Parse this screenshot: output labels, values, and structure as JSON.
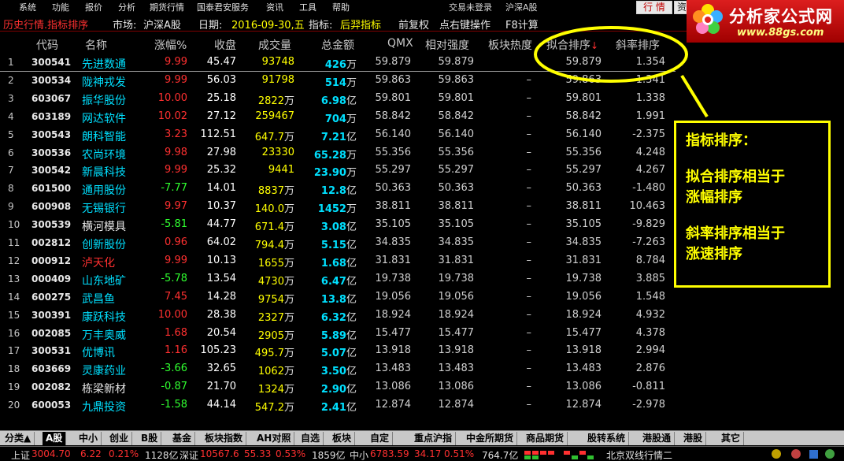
{
  "menu": {
    "items": [
      "系统",
      "功能",
      "报价",
      "分析",
      "期货行情",
      "国泰君安服务",
      "资讯",
      "工具",
      "帮助"
    ],
    "login": "交易未登录",
    "market": "沪深A股"
  },
  "titlebar": {
    "mode": "历史行情.指标排序",
    "market_label": "市场:",
    "market": "沪深A股",
    "date_label": "日期:",
    "date": "2016-09-30,五",
    "indicator_label": "指标:",
    "indicator": "后羿指标",
    "adjust": "前复权",
    "hint": "点右键操作",
    "f8": "F8计算",
    "btn_quote": "行 情",
    "btn_news": "资"
  },
  "logo": {
    "title": "分析家公式网",
    "url": "www.88gs.com"
  },
  "table": {
    "headers": [
      "代码",
      "名称",
      "涨幅%",
      "收盘",
      "成交量",
      "总金额",
      "QMX",
      "相对强度",
      "板块热度",
      "拟合排序",
      "斜率排序"
    ],
    "sort_indicator": "↓",
    "rows": [
      {
        "idx": "1",
        "code": "300541",
        "name": "先进数通",
        "nc": "cyan",
        "chg": "9.99",
        "dir": "up",
        "close": "45.47",
        "vol": "93748",
        "volu": "",
        "amt": "426",
        "amtu": "万",
        "qmx": "59.879",
        "rs": "59.879",
        "heat": "",
        "fit": "59.879",
        "slope": "1.354"
      },
      {
        "idx": "2",
        "code": "300534",
        "name": "陇神戎发",
        "nc": "cyan",
        "chg": "9.99",
        "dir": "up",
        "close": "56.03",
        "vol": "91798",
        "volu": "",
        "amt": "514",
        "amtu": "万",
        "qmx": "59.863",
        "rs": "59.863",
        "heat": "–",
        "fit": "59.863",
        "slope": "1.341"
      },
      {
        "idx": "3",
        "code": "603067",
        "name": "振华股份",
        "nc": "cyan",
        "chg": "10.00",
        "dir": "up",
        "close": "25.18",
        "vol": "2822",
        "volu": "万",
        "amt": "6.98",
        "amtu": "亿",
        "qmx": "59.801",
        "rs": "59.801",
        "heat": "–",
        "fit": "59.801",
        "slope": "1.338"
      },
      {
        "idx": "4",
        "code": "603189",
        "name": "网达软件",
        "nc": "cyan",
        "chg": "10.02",
        "dir": "up",
        "close": "27.12",
        "vol": "259467",
        "volu": "",
        "amt": "704",
        "amtu": "万",
        "qmx": "58.842",
        "rs": "58.842",
        "heat": "–",
        "fit": "58.842",
        "slope": "1.991"
      },
      {
        "idx": "5",
        "code": "300543",
        "name": "朗科智能",
        "nc": "cyan",
        "chg": "3.23",
        "dir": "up",
        "close": "112.51",
        "vol": "647.7",
        "volu": "万",
        "amt": "7.21",
        "amtu": "亿",
        "qmx": "56.140",
        "rs": "56.140",
        "heat": "–",
        "fit": "56.140",
        "slope": "-2.375"
      },
      {
        "idx": "6",
        "code": "300536",
        "name": "农尚环境",
        "nc": "cyan",
        "chg": "9.98",
        "dir": "up",
        "close": "27.98",
        "vol": "23330",
        "volu": "",
        "amt": "65.28",
        "amtu": "万",
        "qmx": "55.356",
        "rs": "55.356",
        "heat": "–",
        "fit": "55.356",
        "slope": "4.248"
      },
      {
        "idx": "7",
        "code": "300542",
        "name": "新晨科技",
        "nc": "cyan",
        "chg": "9.99",
        "dir": "up",
        "close": "25.32",
        "vol": "9441",
        "volu": "",
        "amt": "23.90",
        "amtu": "万",
        "qmx": "55.297",
        "rs": "55.297",
        "heat": "–",
        "fit": "55.297",
        "slope": "4.267"
      },
      {
        "idx": "8",
        "code": "601500",
        "name": "通用股份",
        "nc": "cyan",
        "chg": "-7.77",
        "dir": "down",
        "close": "14.01",
        "vol": "8837",
        "volu": "万",
        "amt": "12.8",
        "amtu": "亿",
        "qmx": "50.363",
        "rs": "50.363",
        "heat": "–",
        "fit": "50.363",
        "slope": "-1.480"
      },
      {
        "idx": "9",
        "code": "600908",
        "name": "无锡银行",
        "nc": "cyan",
        "chg": "9.97",
        "dir": "up",
        "close": "10.37",
        "vol": "140.0",
        "volu": "万",
        "amt": "1452",
        "amtu": "万",
        "qmx": "38.811",
        "rs": "38.811",
        "heat": "–",
        "fit": "38.811",
        "slope": "10.463"
      },
      {
        "idx": "10",
        "code": "300539",
        "name": "横河模具",
        "nc": "white",
        "chg": "-5.81",
        "dir": "down",
        "close": "44.77",
        "vol": "671.4",
        "volu": "万",
        "amt": "3.08",
        "amtu": "亿",
        "qmx": "35.105",
        "rs": "35.105",
        "heat": "–",
        "fit": "35.105",
        "slope": "-9.829"
      },
      {
        "idx": "11",
        "code": "002812",
        "name": "创新股份",
        "nc": "cyan",
        "chg": "0.96",
        "dir": "up",
        "close": "64.02",
        "vol": "794.4",
        "volu": "万",
        "amt": "5.15",
        "amtu": "亿",
        "qmx": "34.835",
        "rs": "34.835",
        "heat": "–",
        "fit": "34.835",
        "slope": "-7.263"
      },
      {
        "idx": "12",
        "code": "000912",
        "name": "泸天化",
        "nc": "red",
        "chg": "9.99",
        "dir": "up",
        "close": "10.13",
        "vol": "1655",
        "volu": "万",
        "amt": "1.68",
        "amtu": "亿",
        "qmx": "31.831",
        "rs": "31.831",
        "heat": "–",
        "fit": "31.831",
        "slope": "8.784"
      },
      {
        "idx": "13",
        "code": "000409",
        "name": "山东地矿",
        "nc": "cyan",
        "chg": "-5.78",
        "dir": "down",
        "close": "13.54",
        "vol": "4730",
        "volu": "万",
        "amt": "6.47",
        "amtu": "亿",
        "qmx": "19.738",
        "rs": "19.738",
        "heat": "–",
        "fit": "19.738",
        "slope": "3.885"
      },
      {
        "idx": "14",
        "code": "600275",
        "name": "武昌鱼",
        "nc": "cyan",
        "chg": "7.45",
        "dir": "up",
        "close": "14.28",
        "vol": "9754",
        "volu": "万",
        "amt": "13.8",
        "amtu": "亿",
        "qmx": "19.056",
        "rs": "19.056",
        "heat": "–",
        "fit": "19.056",
        "slope": "1.548"
      },
      {
        "idx": "15",
        "code": "300391",
        "name": "康跃科技",
        "nc": "cyan",
        "chg": "10.00",
        "dir": "up",
        "close": "28.38",
        "vol": "2327",
        "volu": "万",
        "amt": "6.32",
        "amtu": "亿",
        "qmx": "18.924",
        "rs": "18.924",
        "heat": "–",
        "fit": "18.924",
        "slope": "4.932"
      },
      {
        "idx": "16",
        "code": "002085",
        "name": "万丰奥威",
        "nc": "cyan",
        "chg": "1.68",
        "dir": "up",
        "close": "20.54",
        "vol": "2905",
        "volu": "万",
        "amt": "5.89",
        "amtu": "亿",
        "qmx": "15.477",
        "rs": "15.477",
        "heat": "–",
        "fit": "15.477",
        "slope": "4.378"
      },
      {
        "idx": "17",
        "code": "300531",
        "name": "优博讯",
        "nc": "cyan",
        "chg": "1.16",
        "dir": "up",
        "close": "105.23",
        "vol": "495.7",
        "volu": "万",
        "amt": "5.07",
        "amtu": "亿",
        "qmx": "13.918",
        "rs": "13.918",
        "heat": "–",
        "fit": "13.918",
        "slope": "2.994"
      },
      {
        "idx": "18",
        "code": "603669",
        "name": "灵康药业",
        "nc": "cyan",
        "chg": "-3.66",
        "dir": "down",
        "close": "32.65",
        "vol": "1062",
        "volu": "万",
        "amt": "3.50",
        "amtu": "亿",
        "qmx": "13.483",
        "rs": "13.483",
        "heat": "–",
        "fit": "13.483",
        "slope": "2.876"
      },
      {
        "idx": "19",
        "code": "002082",
        "name": "栋梁新材",
        "nc": "white",
        "chg": "-0.87",
        "dir": "down",
        "close": "21.70",
        "vol": "1324",
        "volu": "万",
        "amt": "2.90",
        "amtu": "亿",
        "qmx": "13.086",
        "rs": "13.086",
        "heat": "–",
        "fit": "13.086",
        "slope": "-0.811"
      },
      {
        "idx": "20",
        "code": "600053",
        "name": "九鼎投资",
        "nc": "cyan",
        "chg": "-1.58",
        "dir": "down",
        "close": "44.14",
        "vol": "547.2",
        "volu": "万",
        "amt": "2.41",
        "amtu": "亿",
        "qmx": "12.874",
        "rs": "12.874",
        "heat": "–",
        "fit": "12.874",
        "slope": "-2.978"
      }
    ]
  },
  "annotation": {
    "title": "指标排序：",
    "line1a": "拟合排序相当于",
    "line1b": "涨幅排序",
    "line2a": "斜率排序相当于",
    "line2b": "涨速排序",
    "color": "#ffff00"
  },
  "tabs": [
    "分类▲",
    "A股",
    "中小",
    "创业",
    "B股",
    "基金",
    "板块指数",
    "AH对照",
    "自选",
    "板块",
    "自定",
    "重点沪指",
    "中金所期货",
    "商品期货",
    "股转系统",
    "港股通",
    "港股",
    "其它"
  ],
  "active_tab": 1,
  "status": {
    "sh_label": "上证",
    "sh_val": "3004.70",
    "sh_chg": "6.22",
    "sh_pct": "0.21%",
    "sh_amt": "1128亿",
    "sz_label": "深证",
    "sz_val": "10567.6",
    "sz_chg": "55.33",
    "sz_pct": "0.53%",
    "sz_amt": "1859亿",
    "zx_label": "中小",
    "zx_val": "6783.59",
    "zx_chg": "34.17",
    "zx_pct": "0.51%",
    "zx_amt": "764.7亿",
    "server": "北京双线行情二"
  },
  "colors": {
    "up": "#ff3030",
    "down": "#30ff30",
    "highlight": "#ffff00",
    "amount": "#00e0ff"
  }
}
